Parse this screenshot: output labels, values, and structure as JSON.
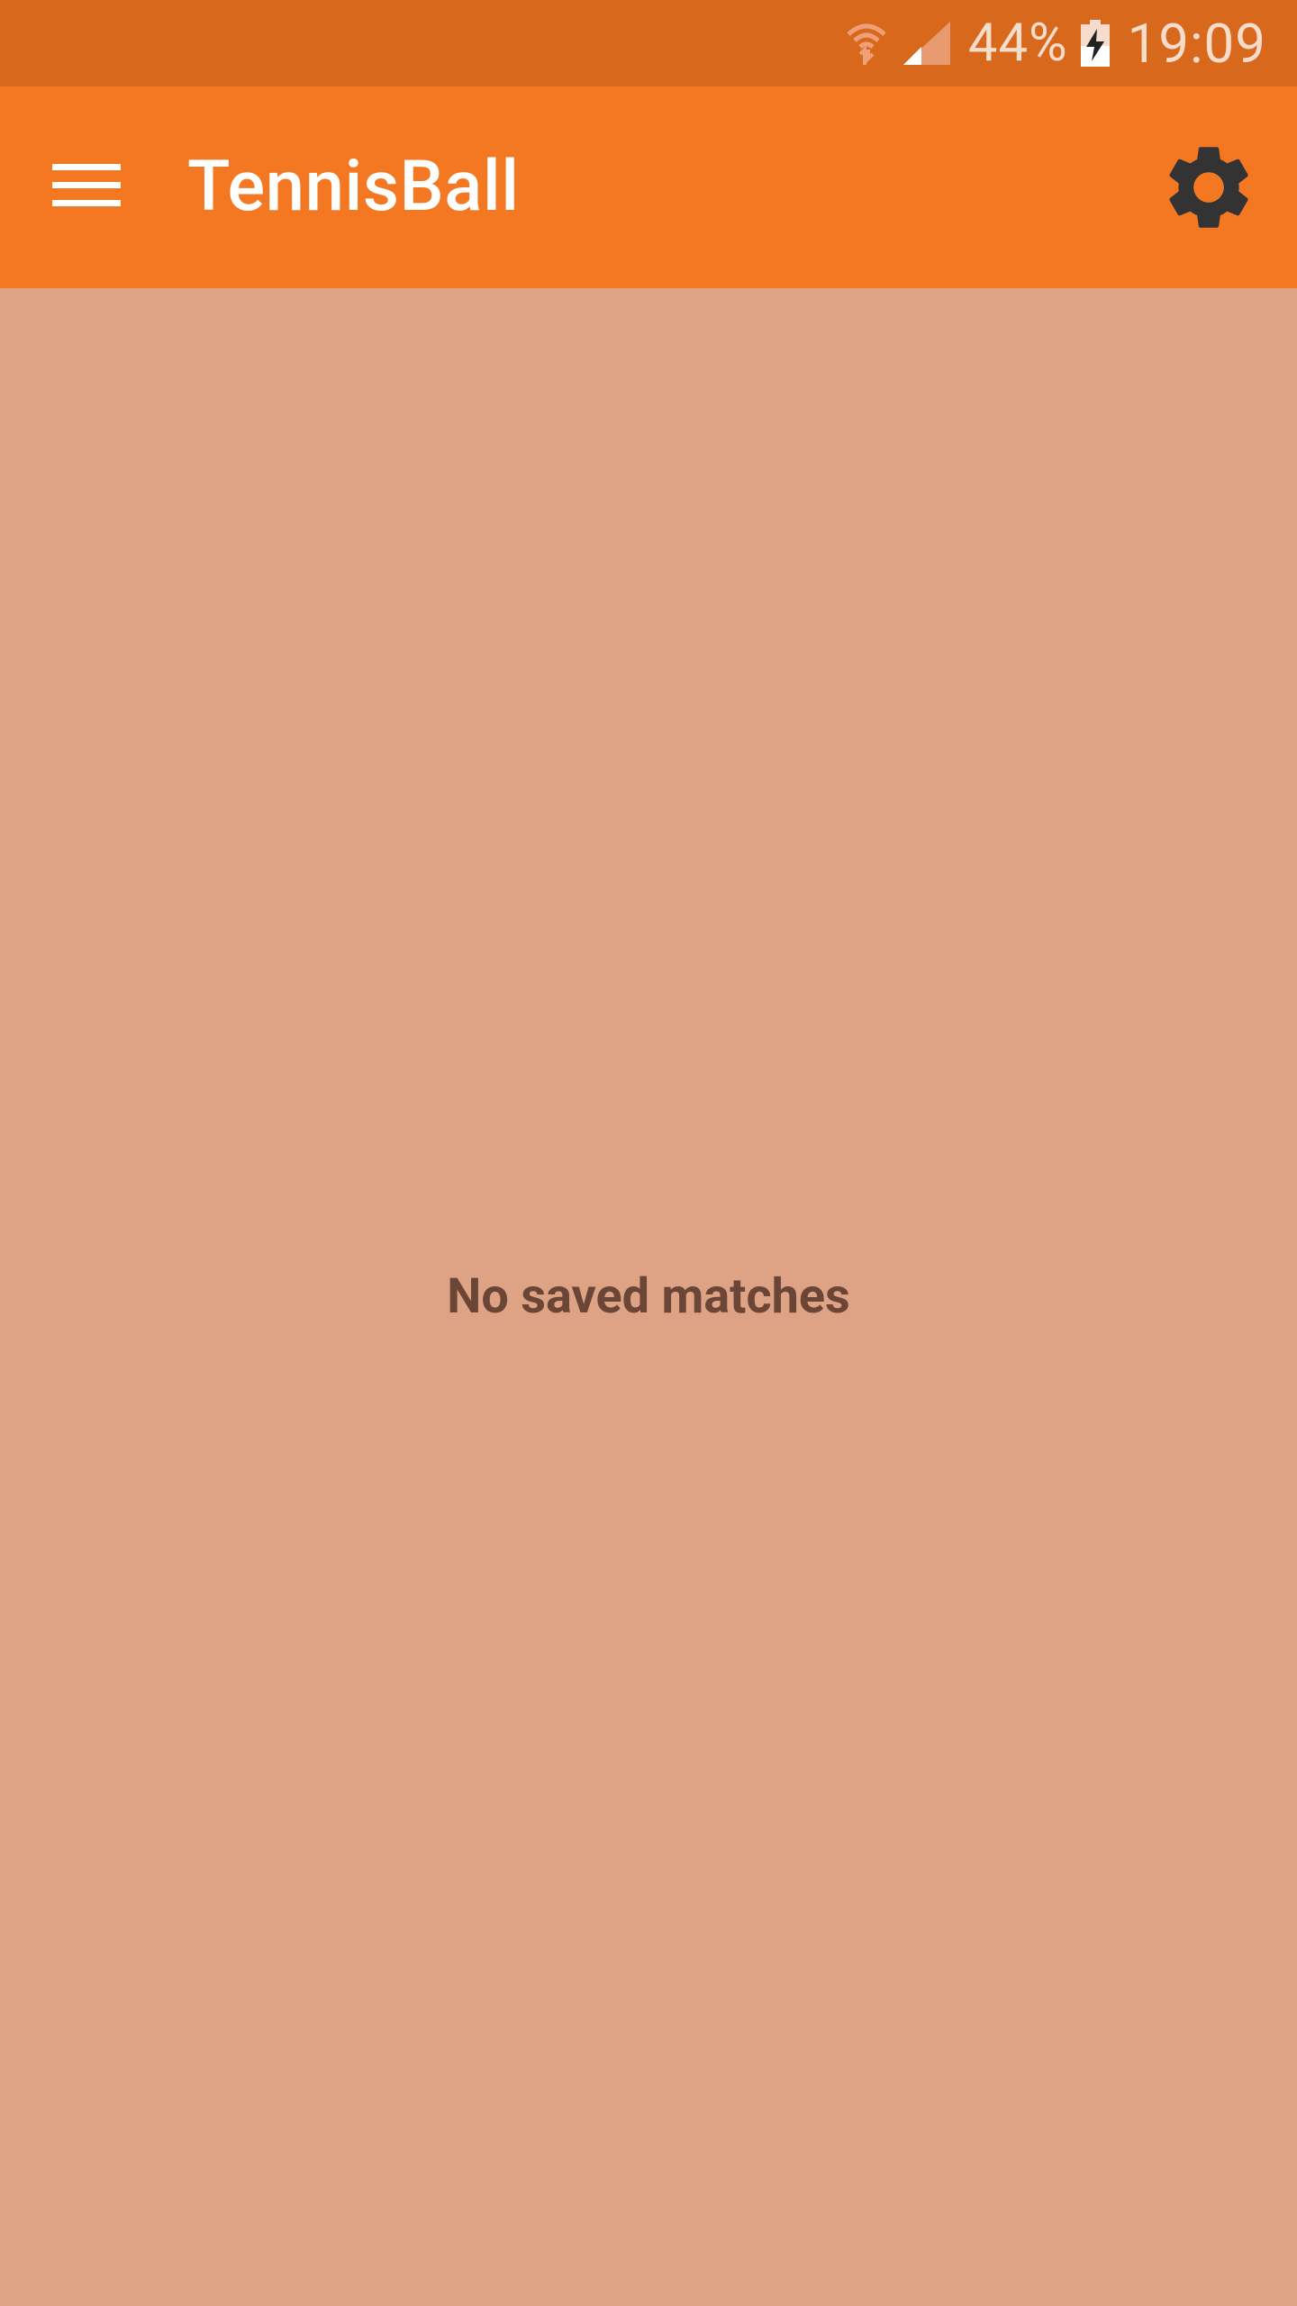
{
  "status_bar": {
    "battery_percent": "44%",
    "time": "19:09",
    "icons": [
      "wifi-icon",
      "signal-icon",
      "battery-charging-icon"
    ]
  },
  "app_bar": {
    "title": "TennisBall",
    "menu_icon": "hamburger-menu-icon",
    "settings_icon": "gear-icon"
  },
  "main": {
    "empty_message": "No saved matches"
  },
  "colors": {
    "status_bar": "#d8681c",
    "app_bar": "#f47721",
    "background": "#dea285",
    "empty_text": "#6b4637",
    "gear": "#333333"
  }
}
